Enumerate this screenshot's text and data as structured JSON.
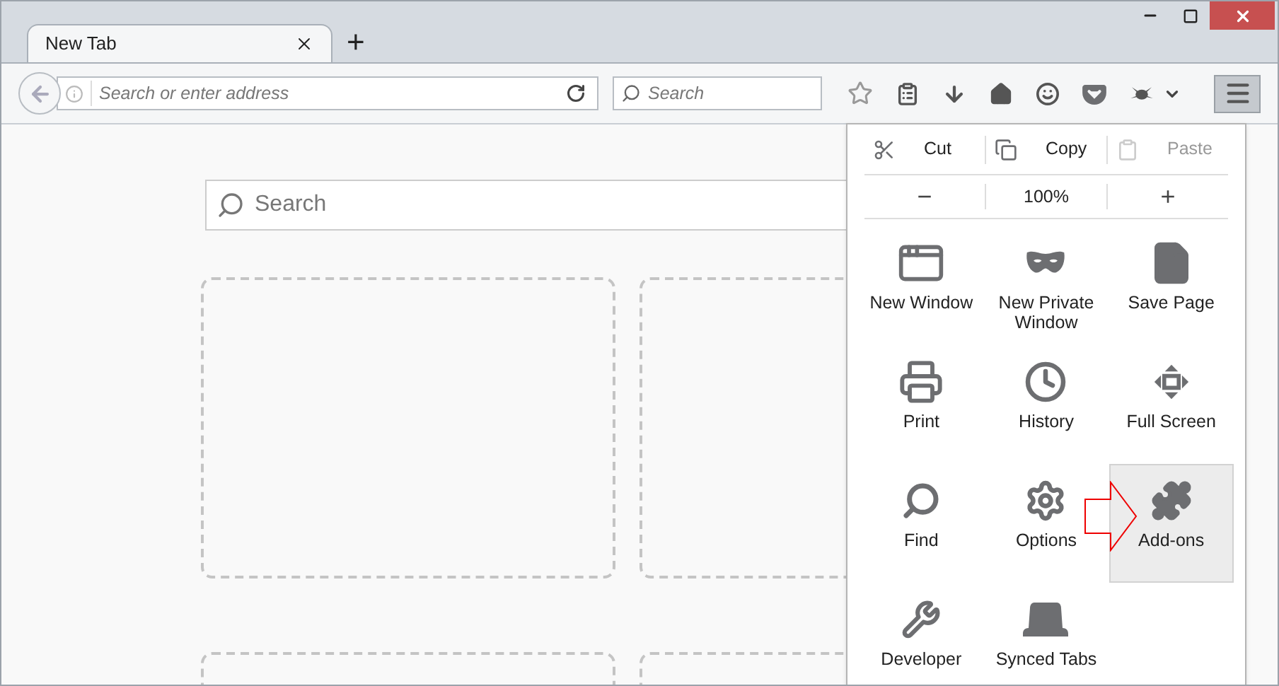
{
  "tabs": [
    {
      "label": "New Tab",
      "selected": true
    }
  ],
  "new_tab_button": "+",
  "address_bar": {
    "placeholder": "Search or enter address"
  },
  "search_bar": {
    "placeholder": "Search"
  },
  "page": {
    "search": {
      "placeholder": "Search"
    }
  },
  "menu": {
    "edit_row": [
      {
        "label": "Cut",
        "kind": "cut",
        "disabled": false
      },
      {
        "label": "Copy",
        "kind": "copy",
        "disabled": false
      },
      {
        "label": "Paste",
        "kind": "paste",
        "disabled": true
      }
    ],
    "zoom_row": {
      "decrease": "−",
      "level": "100%",
      "increase": "+"
    },
    "items": [
      {
        "label": "New Window",
        "kind": "window",
        "selected": false
      },
      {
        "label": "New Private Window",
        "kind": "mask",
        "selected": false
      },
      {
        "label": "Save Page",
        "kind": "page",
        "selected": false
      },
      {
        "label": "Print",
        "kind": "print",
        "selected": false
      },
      {
        "label": "History",
        "kind": "history",
        "selected": false
      },
      {
        "label": "Full Screen",
        "kind": "fullscreen",
        "selected": false
      },
      {
        "label": "Find",
        "kind": "find",
        "selected": false
      },
      {
        "label": "Options",
        "kind": "options",
        "selected": false
      },
      {
        "label": "Add-ons",
        "kind": "addons",
        "selected": true
      },
      {
        "label": "Developer",
        "kind": "developer",
        "selected": false
      },
      {
        "label": "Synced Tabs",
        "kind": "synced",
        "selected": false
      }
    ]
  }
}
